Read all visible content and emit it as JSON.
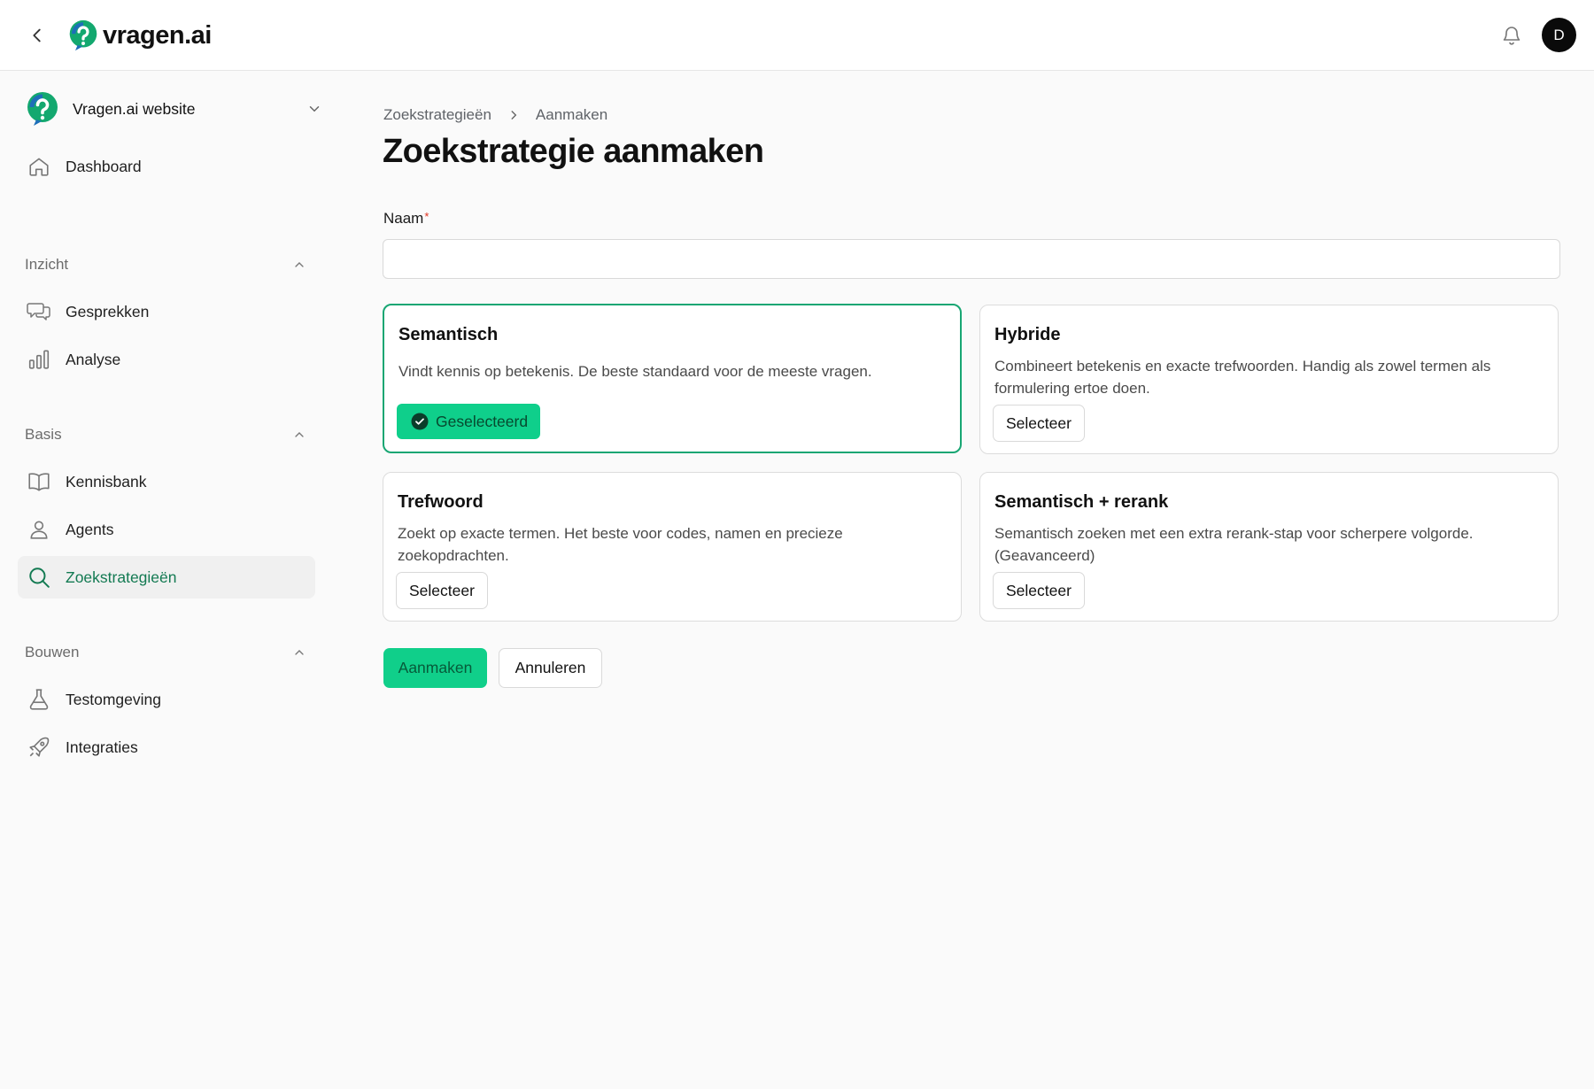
{
  "header": {
    "brand_name": "vragen.ai",
    "avatar_initial": "D",
    "icons": {
      "back": "chevron-left-icon",
      "notifications": "bell-icon"
    }
  },
  "sidebar": {
    "workspace": {
      "name": "Vragen.ai website"
    },
    "dashboard": {
      "label": "Dashboard",
      "icon": "home-icon"
    },
    "sections": [
      {
        "label": "Inzicht",
        "items": [
          {
            "label": "Gesprekken",
            "icon": "chat-bubbles-icon"
          },
          {
            "label": "Analyse",
            "icon": "bar-chart-icon"
          }
        ]
      },
      {
        "label": "Basis",
        "items": [
          {
            "label": "Kennisbank",
            "icon": "book-icon"
          },
          {
            "label": "Agents",
            "icon": "user-icon"
          },
          {
            "label": "Zoekstrategieën",
            "icon": "search-icon",
            "active": true
          }
        ]
      },
      {
        "label": "Bouwen",
        "items": [
          {
            "label": "Testomgeving",
            "icon": "flask-icon"
          },
          {
            "label": "Integraties",
            "icon": "rocket-icon"
          }
        ]
      }
    ]
  },
  "breadcrumb": {
    "parent": "Zoekstrategieën",
    "current": "Aanmaken"
  },
  "page": {
    "title": "Zoekstrategie aanmaken"
  },
  "form": {
    "name_label": "Naam",
    "required_mark": "*",
    "name_value": "",
    "strategies": [
      {
        "title": "Semantisch",
        "description": "Vindt kennis op betekenis. De beste standaard voor de meeste vragen.",
        "selected": true,
        "button_label": "Geselecteerd"
      },
      {
        "title": "Hybride",
        "description": "Combineert betekenis en exacte trefwoorden. Handig als zowel termen als formulering ertoe doen.",
        "selected": false,
        "button_label": "Selecteer"
      },
      {
        "title": "Trefwoord",
        "description": "Zoekt op exacte termen. Het beste voor codes, namen en precieze zoekopdrachten.",
        "selected": false,
        "button_label": "Selecteer"
      },
      {
        "title": "Semantisch + rerank",
        "description": "Semantisch zoeken met een extra rerank-stap voor scherpere volgorde. (Geavanceerd)",
        "selected": false,
        "button_label": "Selecteer"
      }
    ],
    "submit_label": "Aanmaken",
    "cancel_label": "Annuleren"
  },
  "colors": {
    "accent": "#10cf8a",
    "accent_border": "#18a673",
    "active_nav_text": "#137a52",
    "required": "#e0301e"
  }
}
